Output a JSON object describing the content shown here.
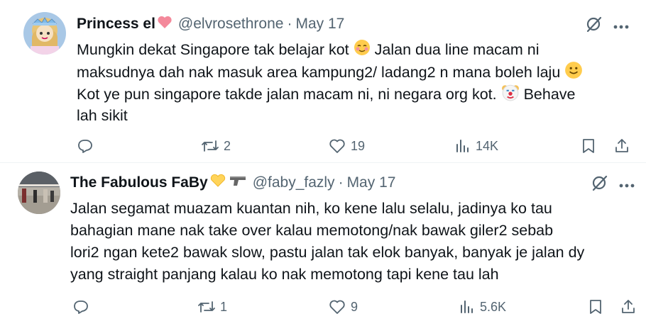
{
  "tweets": [
    {
      "author_name": "Princess el",
      "author_emoji": "heart-icon",
      "handle": "@elvrosethrone",
      "separator": "·",
      "date": "May 17",
      "lines": [
        "Mungkin dekat Singapore tak belajar kot",
        "Jalan dua line macam ni",
        "maksudnya dah nak masuk area kampung2/ ladang2 n mana boleh laju",
        "Kot ye pun singapore takde jalan macam ni, ni negara org kot.",
        "Behave",
        "lah sikit"
      ],
      "stats": {
        "replies": "",
        "reposts": "2",
        "likes": "19",
        "views": "14K"
      }
    },
    {
      "author_name": "The Fabulous FaBy",
      "author_emoji": "heart-hands-icon",
      "handle": "@faby_fazly",
      "separator": "·",
      "date": "May 17",
      "lines": [
        "Jalan segamat muazam kuantan nih, ko kene lalu selalu, jadinya ko tau",
        "bahagian mane nak take over kalau memotong/nak bawak giler2 sebab",
        "lori2 ngan kete2 bawak slow, pastu jalan tak elok banyak, banyak je jalan dy",
        "yang straight panjang kalau ko nak memotong tapi kene tau lah"
      ],
      "stats": {
        "replies": "",
        "reposts": "1",
        "likes": "9",
        "views": "5.6K"
      }
    }
  ],
  "colors": {
    "text": "#0f1419",
    "muted": "#536471",
    "divider": "#eff3f4",
    "heart": "#f4899b"
  }
}
